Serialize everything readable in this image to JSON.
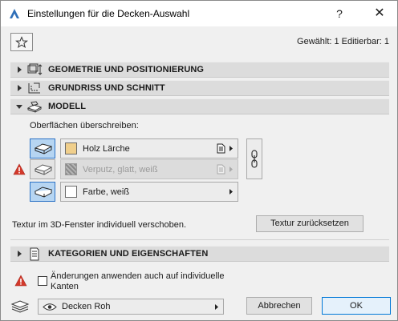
{
  "window": {
    "title": "Einstellungen für die Decken-Auswahl",
    "help_label": "?",
    "close_label": "✕"
  },
  "selection_info": "Gewählt: 1 Editierbar: 1",
  "sections": {
    "geometry": {
      "label": "GEOMETRIE UND POSITIONIERUNG",
      "expanded": false
    },
    "floorplan": {
      "label": "GRUNDRISS UND SCHNITT",
      "expanded": false
    },
    "model": {
      "label": "MODELL",
      "expanded": true
    },
    "categories": {
      "label": "KATEGORIEN UND EIGENSCHAFTEN",
      "expanded": false
    }
  },
  "model": {
    "override_label": "Oberflächen überschreiben:",
    "surfaces": [
      {
        "name": "Holz Lärche",
        "swatch": "#f0cf8c",
        "enabled": true
      },
      {
        "name": "Verputz, glatt, weiß",
        "swatch": "#9a9a9a",
        "enabled": false
      },
      {
        "name": "Farbe, weiß",
        "swatch": "#ffffff",
        "enabled": true
      }
    ],
    "texture_text": "Textur im 3D-Fenster individuell verschoben.",
    "reset_texture_label": "Textur zurücksetzen"
  },
  "footer": {
    "apply_edges_label": "Änderungen anwenden auch auf individuelle Kanten",
    "layer_name": "Decken Roh",
    "cancel_label": "Abbrechen",
    "ok_label": "OK"
  },
  "colors": {
    "accent": "#2c73c6",
    "warning": "#d3392b",
    "section_bg": "#dcdcdc"
  }
}
